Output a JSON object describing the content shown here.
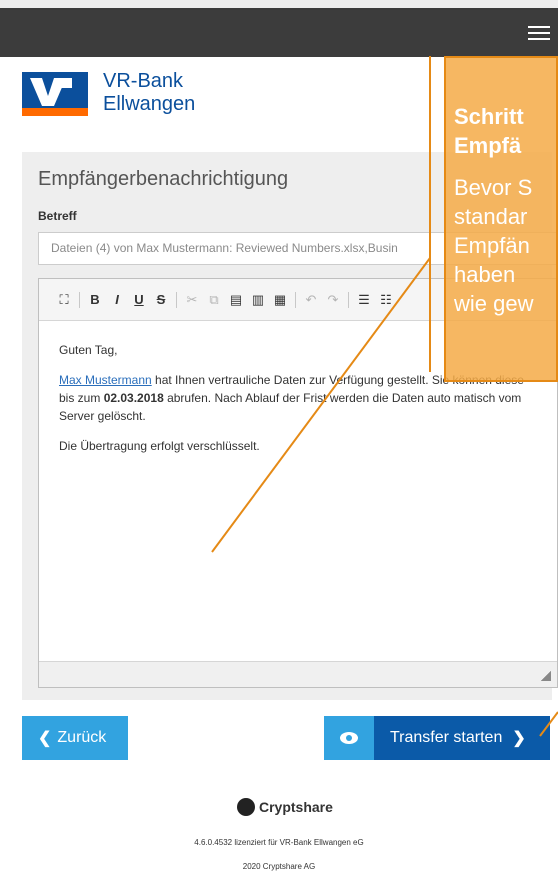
{
  "header": {
    "menu_icon": "hamburger-icon"
  },
  "logo": {
    "line1": "VR-Bank",
    "line2": "Ellwangen",
    "brand_blue": "#0b4f9c",
    "brand_orange": "#ff6a00"
  },
  "panel": {
    "title": "Empfängerbenachrichtigung",
    "betreff_label": "Betreff",
    "betreff_value": "Dateien (4) von Max Mustermann: Reviewed Numbers.xlsx,Busin",
    "editor": {
      "toolbar": [
        "fullscreen-icon",
        "bold-icon",
        "italic-icon",
        "underline-icon",
        "strikethrough-icon",
        "cut-icon",
        "copy-icon",
        "paste-icon",
        "paste-text-icon",
        "paste-word-icon",
        "undo-icon",
        "redo-icon",
        "numbered-list-icon",
        "bulleted-list-icon"
      ],
      "greeting": "Guten Tag,",
      "p1_link": "Max Mustermann",
      "p1_a": " hat Ihnen vertrauliche Daten zur Verfügung gestellt. Sie können diese bis zum ",
      "p1_date": "02.03.2018",
      "p1_b": " abrufen. Nach Ablauf der Frist werden die Daten auto matisch vom Server gelöscht.",
      "p2": "Die Übertragung erfolgt verschlüsselt."
    }
  },
  "buttons": {
    "back": "Zurück",
    "start": "Transfer starten",
    "eye_icon": "eye-icon"
  },
  "footer": {
    "brand": "Cryptshare",
    "license": "4.6.0.4532 lizenziert für VR-Bank Ellwangen eG",
    "copyright": "2020 Cryptshare AG"
  },
  "overlay": {
    "title_line1": "Schritt",
    "title_line2": "Empfä",
    "body_line1": "Bevor S",
    "body_line2": "standar",
    "body_line3": "Empfän",
    "body_line4": "haben",
    "body_line5": "wie gew",
    "accent": "#e58a16"
  }
}
